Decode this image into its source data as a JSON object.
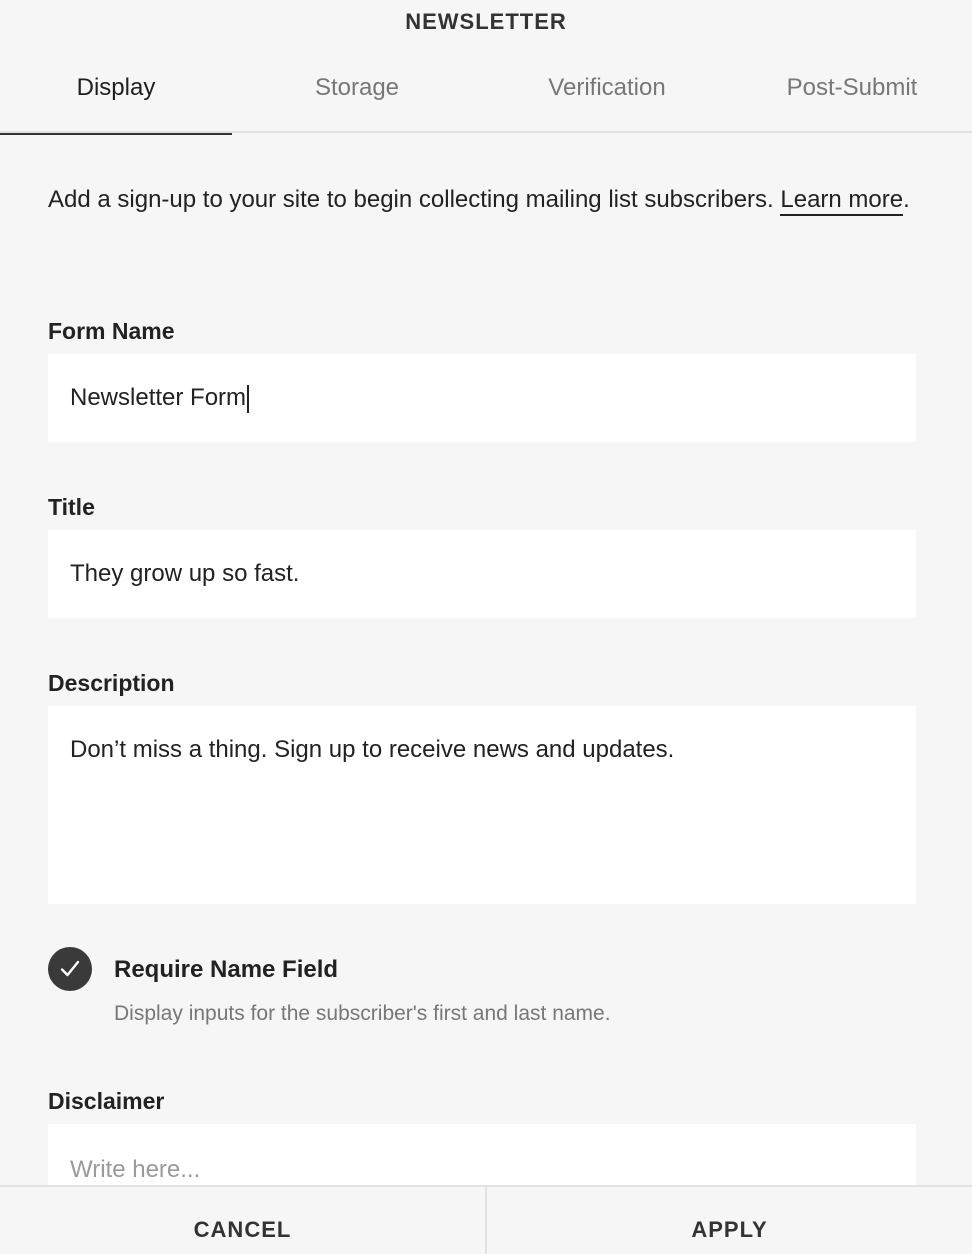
{
  "header": {
    "title": "NEWSLETTER"
  },
  "tabs": [
    {
      "label": "Display",
      "active": true
    },
    {
      "label": "Storage",
      "active": false
    },
    {
      "label": "Verification",
      "active": false
    },
    {
      "label": "Post-Submit",
      "active": false
    }
  ],
  "intro": {
    "text": "Add a sign-up to your site to begin collecting mailing list subscribers. ",
    "link": "Learn more",
    "suffix": "."
  },
  "form": {
    "form_name": {
      "label": "Form Name",
      "value": "Newsletter Form"
    },
    "title": {
      "label": "Title",
      "value": "They grow up so fast."
    },
    "description": {
      "label": "Description",
      "value": "Don’t miss a thing. Sign up to receive news and updates."
    },
    "require_name": {
      "label": "Require Name Field",
      "description": "Display inputs for the subscriber's first and last name.",
      "checked": true
    },
    "disclaimer": {
      "label": "Disclaimer",
      "placeholder": "Write here..."
    }
  },
  "footer": {
    "cancel_label": "CANCEL",
    "apply_label": "APPLY"
  },
  "colors": {
    "background": "#f6f6f6",
    "field": "#ffffff",
    "accent": "#3a3a3a"
  }
}
